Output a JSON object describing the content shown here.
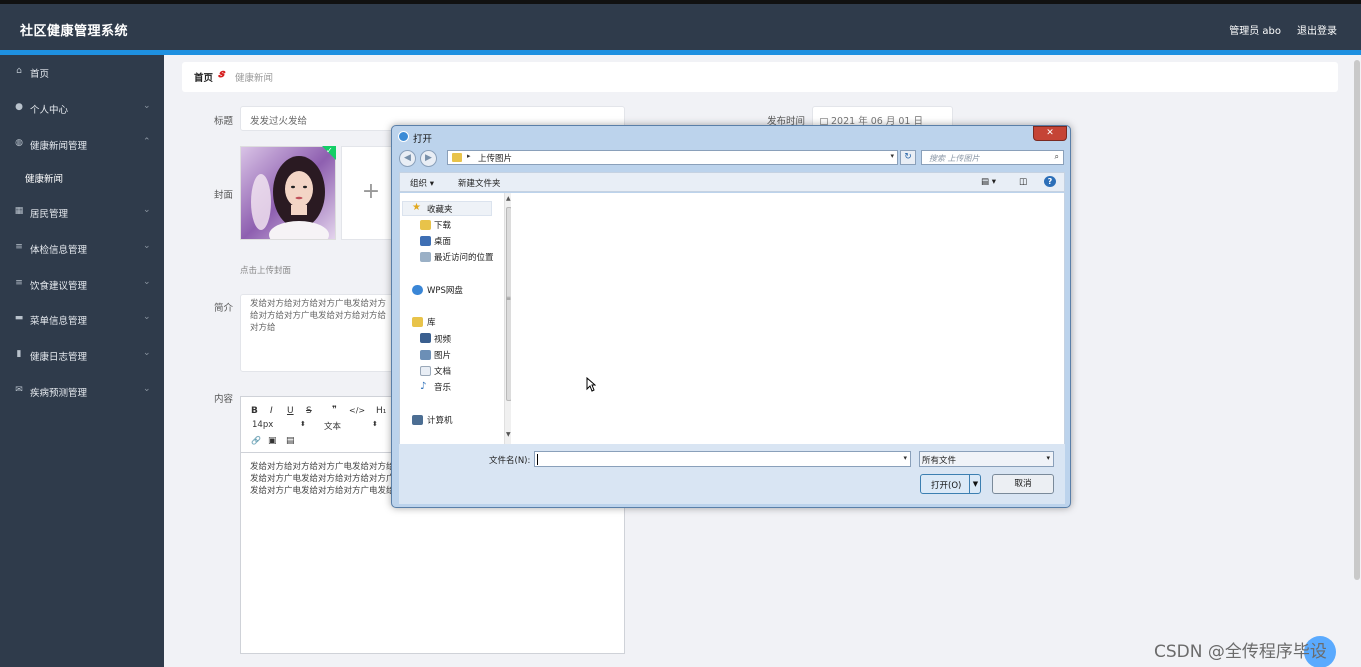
{
  "header": {
    "brand": "社区健康管理系统",
    "user": "管理员 abo",
    "logout": "退出登录",
    "accent": "#1e90e0"
  },
  "sidebar": {
    "items": [
      {
        "label": "首页",
        "icon": "home-icon",
        "glyph": "⌂"
      },
      {
        "label": "个人中心",
        "icon": "person-icon",
        "glyph": "●",
        "chevron": "⌄"
      },
      {
        "label": "健康新闻管理",
        "icon": "globe-icon",
        "glyph": "◍",
        "chevron": "⌃"
      },
      {
        "label": "居民管理",
        "icon": "grid-icon",
        "glyph": "▦",
        "chevron": "⌄"
      },
      {
        "label": "体检信息管理",
        "icon": "list-icon",
        "glyph": "≡",
        "chevron": "⌄"
      },
      {
        "label": "饮食建议管理",
        "icon": "list-icon",
        "glyph": "≡",
        "chevron": "⌄"
      },
      {
        "label": "菜单信息管理",
        "icon": "stack-icon",
        "glyph": "▬",
        "chevron": "⌄"
      },
      {
        "label": "健康日志管理",
        "icon": "chart-icon",
        "glyph": "▮",
        "chevron": "⌄"
      },
      {
        "label": "疾病预测管理",
        "icon": "mail-icon",
        "glyph": "✉",
        "chevron": "⌄"
      }
    ],
    "subitem": "健康新闻"
  },
  "breadcrumb": {
    "home": "首页",
    "sep": "𝒔",
    "current": "健康新闻"
  },
  "form": {
    "title_label": "标题",
    "title_value": "发发过火发给",
    "pubtime_label": "发布时间",
    "pubtime_value": "2021 年 06 月 01 日",
    "cover_label": "封面",
    "cover_hint": "点击上传封面",
    "cover_add": "+",
    "desc_label": "简介",
    "desc_value": "发给对方给对方给对方广电发给对方给对方给对方广电发给对方给对方给对方给",
    "content_label": "内容",
    "editor": {
      "bold": "B",
      "italic": "I",
      "underline": "U",
      "strike": "S",
      "quote": "❞",
      "code": "</>",
      "h1": "H₁",
      "size": "14px",
      "style": "文本",
      "arrow": "⬍",
      "link": "🔗",
      "image": "▣",
      "video": "▤",
      "lines": [
        "发给对方给对方给对方广电发给对方给对方",
        "发给对方广电发给对方给对方给对方广电发",
        "发给对方广电发给对方给对方广电发给对方给对方"
      ]
    }
  },
  "dialog": {
    "title": "打开",
    "close": "✕",
    "back": "◀",
    "forward": "▶",
    "path": "上传图片",
    "path_arrow": "▸",
    "drop": "▾",
    "refresh": "↻",
    "search_placeholder": "搜索 上传图片",
    "search_glyph": "⌕",
    "organize": "组织 ▾",
    "new_folder": "新建文件夹",
    "view_glyph": "▤ ▾",
    "pane_glyph": "◫",
    "help_glyph": "?",
    "nav": {
      "favorites": "收藏夹",
      "downloads": "下载",
      "desktop": "桌面",
      "recent": "最近访问的位置",
      "wps": "WPS网盘",
      "library": "库",
      "videos": "视频",
      "pictures": "图片",
      "documents": "文档",
      "music": "音乐",
      "computer": "计算机"
    },
    "scroll_up": "▲",
    "scroll_down": "▼",
    "scroll_grip": "≡",
    "filename_label": "文件名(N):",
    "filename_value": "",
    "filetype": "所有文件",
    "open_button": "打开(O)",
    "open_split": "▼",
    "cancel_button": "取消"
  },
  "watermark": "CSDN @全传程序毕设"
}
